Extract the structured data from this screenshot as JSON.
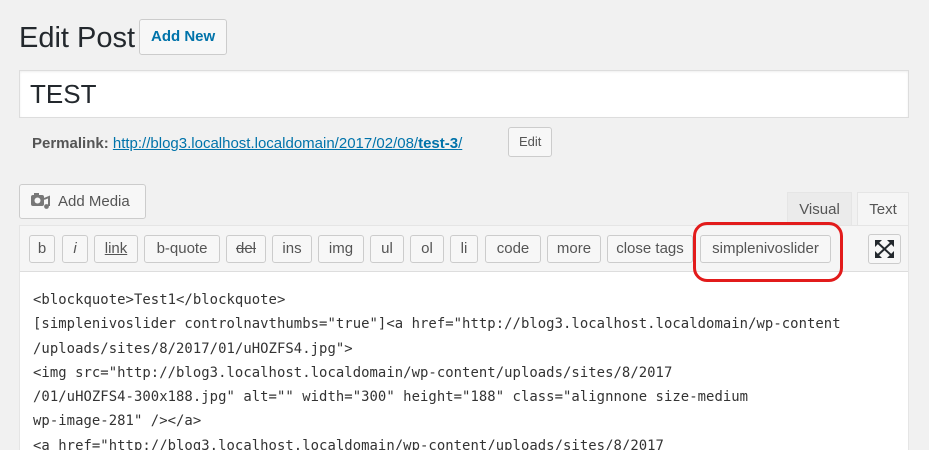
{
  "header": {
    "title": "Edit Post",
    "add_new_label": "Add New"
  },
  "post": {
    "title": "TEST"
  },
  "permalink": {
    "label": "Permalink:",
    "url_prefix": "http://blog3.localhost.localdomain/2017/02/08/",
    "slug": "test-3",
    "url_suffix": "/",
    "edit_label": "Edit"
  },
  "media": {
    "add_media_label": "Add Media",
    "icon": "camera-music-icon"
  },
  "editor_tabs": {
    "visual": "Visual",
    "text": "Text",
    "active": "Text"
  },
  "quicktags": {
    "b": "b",
    "i": "i",
    "link": "link",
    "b_quote": "b-quote",
    "del": "del",
    "ins": "ins",
    "img": "img",
    "ul": "ul",
    "ol": "ol",
    "li": "li",
    "code": "code",
    "more": "more",
    "close_tags": "close tags",
    "simplenivoslider": "simplenivoslider"
  },
  "editor_lines": [
    "<blockquote>Test1</blockquote>",
    "[simplenivoslider controlnavthumbs=\"true\"]<a href=\"http://blog3.localhost.localdomain/wp-content",
    "/uploads/sites/8/2017/01/uHOZFS4.jpg\">",
    "<img src=\"http://blog3.localhost.localdomain/wp-content/uploads/sites/8/2017",
    "/01/uHOZFS4-300x188.jpg\" alt=\"\" width=\"300\" height=\"188\" class=\"alignnone size-medium",
    "wp-image-281\" /></a>",
    "<a href=\"http://blog3.localhost.localdomain/wp-content/uploads/sites/8/2017"
  ],
  "colors": {
    "accent": "#0073aa",
    "highlight": "#e21b1b"
  }
}
